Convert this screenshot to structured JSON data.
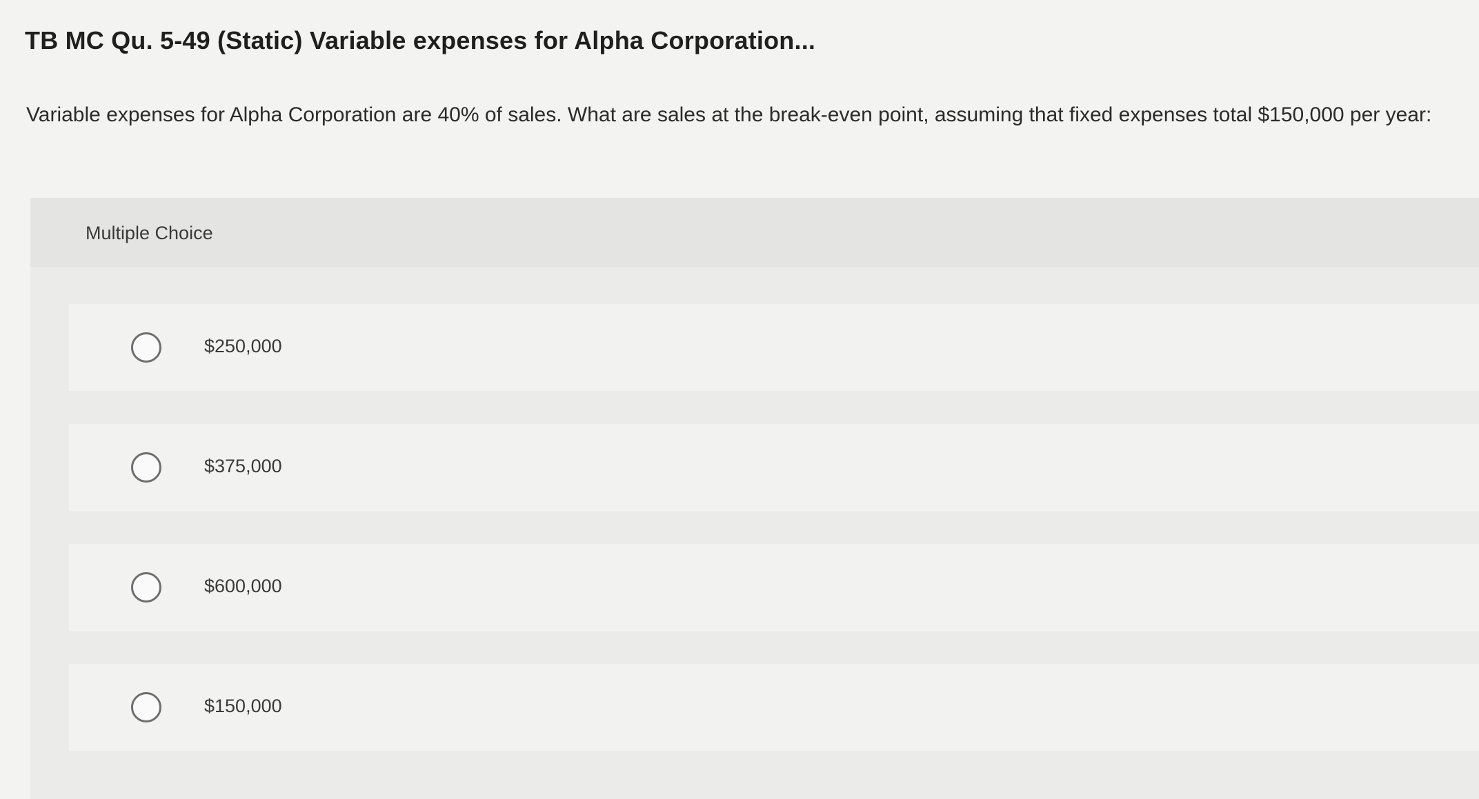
{
  "question": {
    "title": "TB MC Qu. 5-49 (Static) Variable expenses for Alpha Corporation...",
    "text": "Variable expenses for Alpha Corporation are 40% of sales. What are sales at the break-even point, assuming that fixed expenses total $150,000 per year:"
  },
  "multiple_choice": {
    "header": "Multiple Choice",
    "options": [
      {
        "label": "$250,000",
        "selected": false
      },
      {
        "label": "$375,000",
        "selected": false
      },
      {
        "label": "$600,000",
        "selected": false
      },
      {
        "label": "$150,000",
        "selected": false
      }
    ]
  },
  "icons": {
    "radio": "radio-unselected-icon"
  }
}
